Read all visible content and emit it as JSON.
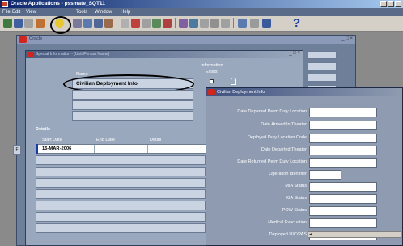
{
  "app": {
    "title": "Oracle Applications - pssmate_SQT11"
  },
  "menu": {
    "items": [
      "File",
      "Edit",
      "View",
      "Tools",
      "Window",
      "Help"
    ]
  },
  "toolbar": {
    "help_glyph": "?"
  },
  "mdi": {
    "title": "Oracle",
    "controls": "_ □ ×"
  },
  "form": {
    "title": "Special Information - (Unit/Person Name)",
    "controls": "_ □ ×",
    "information_label": "Information",
    "exists_label": "Exists",
    "name_label": "Name",
    "name_value": "Civilian Deployment Info",
    "details_label": "Details",
    "columns": [
      "Start Date",
      "End Date",
      "Detail"
    ],
    "rows": [
      {
        "start": "15-MAR-2006",
        "end": "",
        "detail": ""
      }
    ],
    "side_box": "F"
  },
  "popup": {
    "title": "Civilian Deployment Info",
    "fields": [
      "Date Departed Perm Duty Location",
      "Date Arrived In Theater",
      "Deployed Duty Location Code",
      "Date Departed Theater",
      "Date Returned Perm Duty Location",
      "Operation Identifier",
      "MIA Status",
      "KIA Status",
      "POW Status",
      "Medical Evacuation",
      "Deployed UIC/PAS"
    ]
  },
  "colors": {
    "title_bar": "#0a246a",
    "form_bg": "#9aa8bd",
    "popup_bg": "#8e9bb0",
    "accent_red": "#d8231b",
    "row_marker": "#1c3ab0"
  }
}
